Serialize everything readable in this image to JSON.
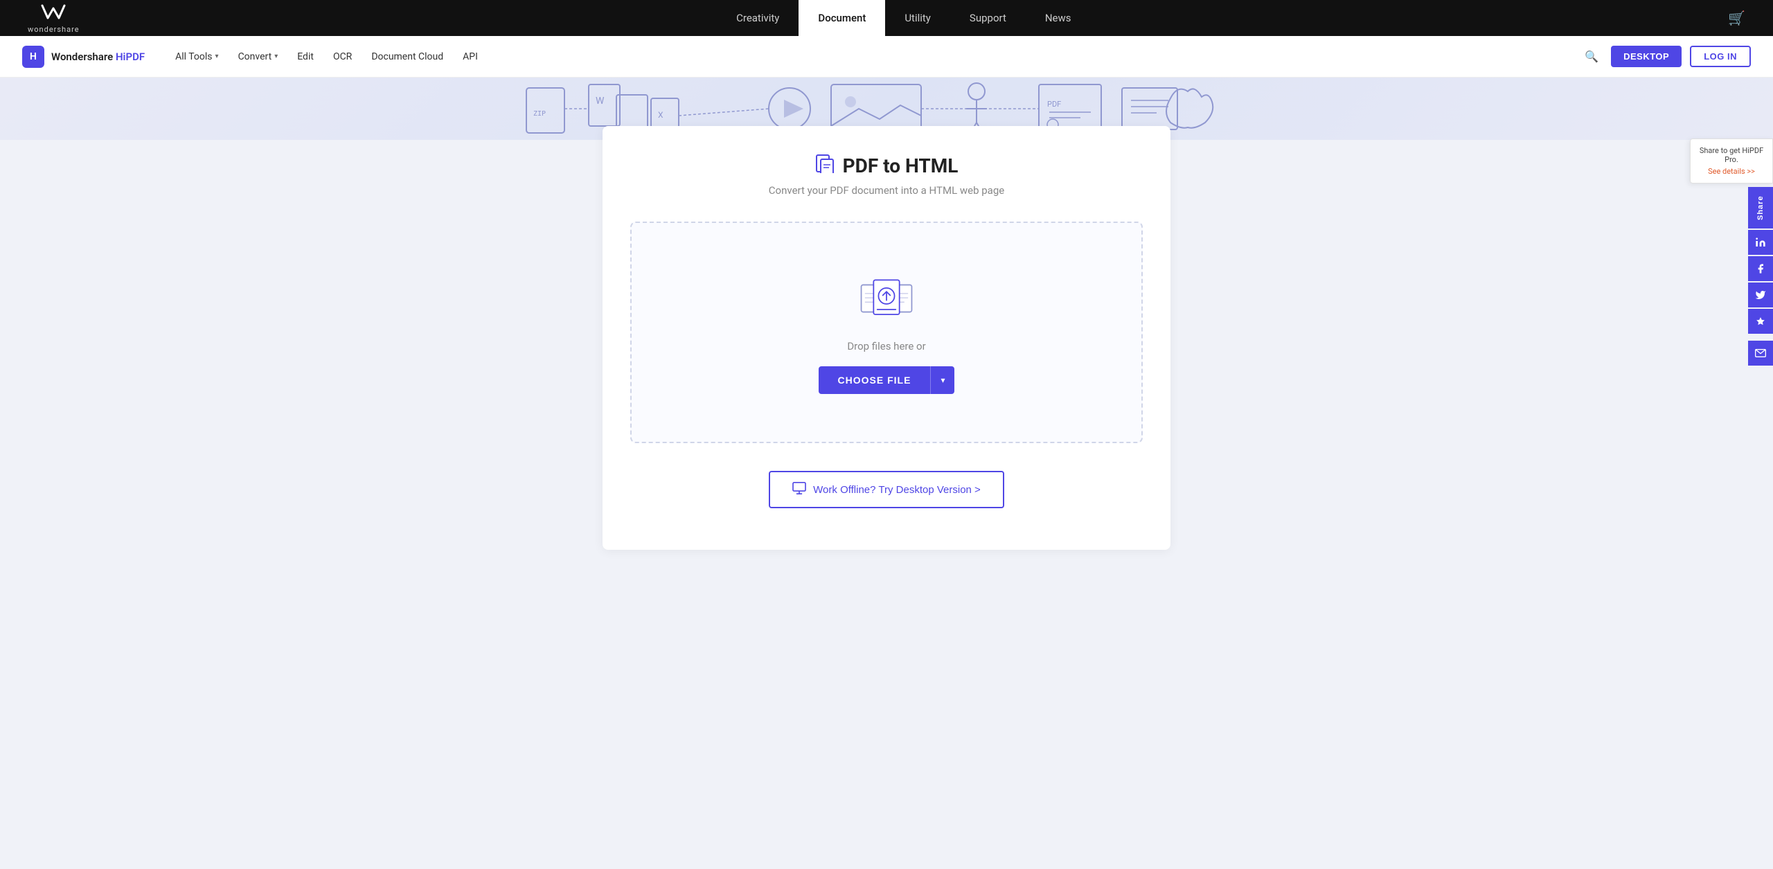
{
  "topNav": {
    "logo": {
      "icon": "⌘",
      "text": "wondershare"
    },
    "links": [
      {
        "label": "Creativity",
        "active": false
      },
      {
        "label": "Document",
        "active": true
      },
      {
        "label": "Utility",
        "active": false
      },
      {
        "label": "Support",
        "active": false
      },
      {
        "label": "News",
        "active": false
      }
    ]
  },
  "secondaryNav": {
    "brand": "Wondershare HiPDF",
    "links": [
      {
        "label": "All Tools",
        "hasDropdown": true
      },
      {
        "label": "Convert",
        "hasDropdown": true
      },
      {
        "label": "Edit",
        "hasDropdown": false
      },
      {
        "label": "OCR",
        "hasDropdown": false
      },
      {
        "label": "Document Cloud",
        "hasDropdown": false
      },
      {
        "label": "API",
        "hasDropdown": false
      }
    ],
    "desktopBtn": "DESKTOP",
    "loginBtn": "LOG IN"
  },
  "sharePromo": {
    "text": "Share to get HiPDF Pro.",
    "link": "See details >>"
  },
  "shareSidebar": {
    "label": "Share",
    "buttons": [
      "linkedin",
      "facebook",
      "twitter",
      "bookmark",
      "email"
    ]
  },
  "main": {
    "titleIcon": "📄",
    "title": "PDF to HTML",
    "subtitle": "Convert your PDF document into a HTML web page",
    "uploadZone": {
      "dropText": "Drop files here or",
      "chooseFileBtn": "CHOOSE FILE",
      "dropdownChevron": "▾"
    },
    "desktopBtn": "Work Offline? Try Desktop Version >"
  }
}
